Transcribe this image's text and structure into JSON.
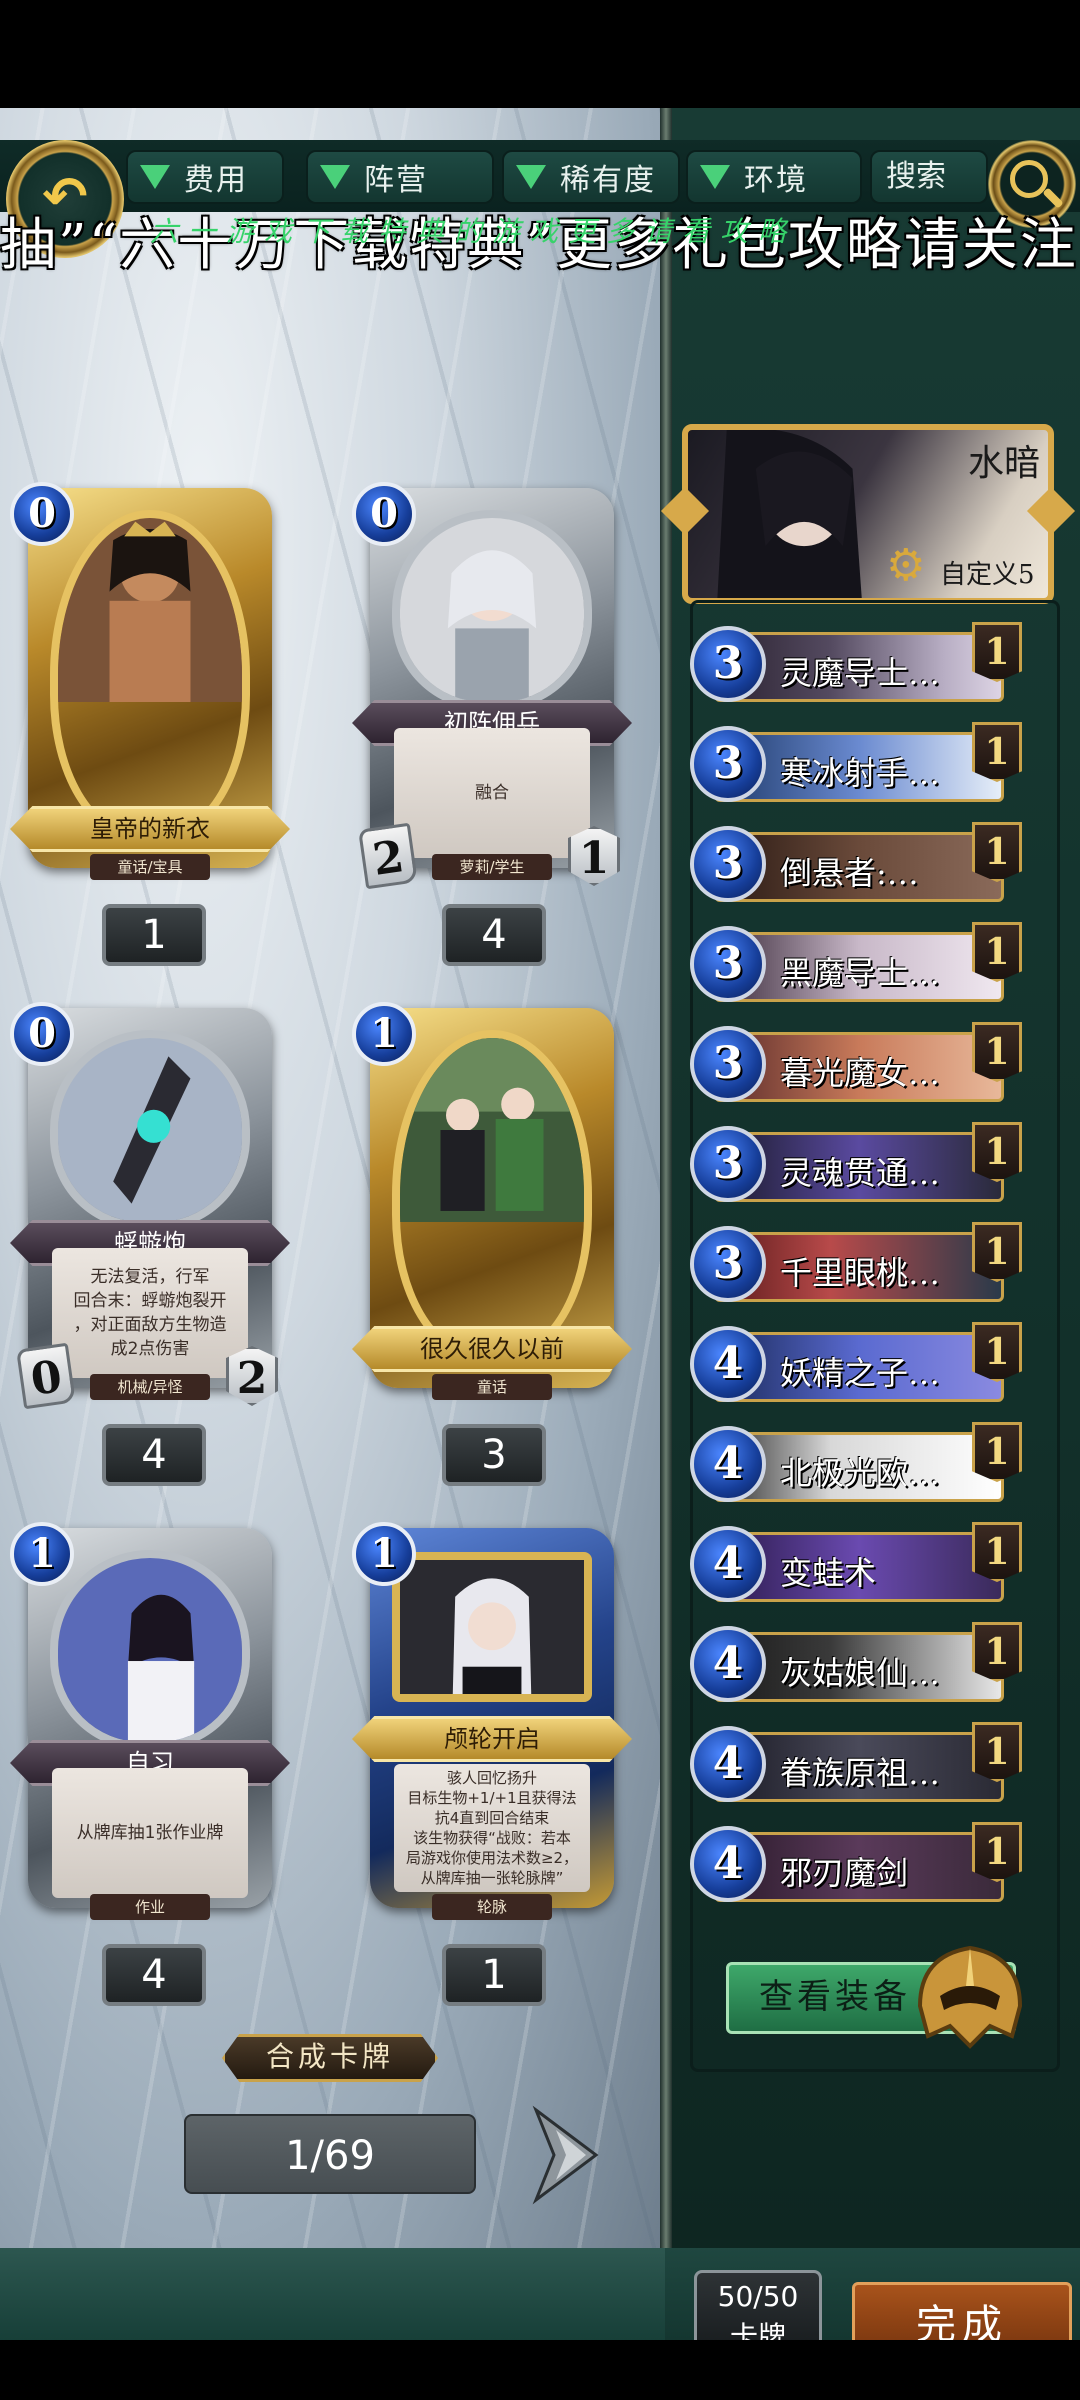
{
  "filters": {
    "back_icon": "back-arrow-icon",
    "cost": "费用",
    "faction": "阵营",
    "rarity": "稀有度",
    "environment": "环境",
    "search": "搜索",
    "search_icon": "magnifier-icon"
  },
  "banner": {
    "main": "抽”“六十万下载特典”更多礼包攻略请关注",
    "overlay": "六一游戏下载特典的游戏更多请看攻略"
  },
  "cards": [
    {
      "cost": "0",
      "name": "皇帝的新衣",
      "tribe": "童话/宝具",
      "text": "",
      "atk": "",
      "hp": "",
      "qty": "1",
      "frame": "gold"
    },
    {
      "cost": "0",
      "name": "初阵佣兵",
      "tribe": "萝莉/学生",
      "text": "融合",
      "atk": "2",
      "hp": "1",
      "qty": "4",
      "frame": "silver"
    },
    {
      "cost": "0",
      "name": "蜉蝣炮",
      "tribe": "机械/异怪",
      "text": "无法复活，行军\n回合末：蜉蝣炮裂开\n，对正面敌方生物造\n成2点伤害",
      "atk": "0",
      "hp": "2",
      "qty": "4",
      "frame": "silver"
    },
    {
      "cost": "1",
      "name": "很久很久以前",
      "tribe": "童话",
      "text": "",
      "atk": "",
      "hp": "",
      "qty": "3",
      "frame": "gold"
    },
    {
      "cost": "1",
      "name": "自习",
      "tribe": "作业",
      "text": "从牌库抽1张作业牌",
      "atk": "",
      "hp": "",
      "qty": "4",
      "frame": "silver"
    },
    {
      "cost": "1",
      "name": "颅轮开启",
      "tribe": "轮脉",
      "text": "骇人回忆扬升\n目标生物+1/+1且获得法\n抗4直到回合结束\n该生物获得“战败：若本\n局游戏你使用法术数≥2，\n从牌库抽一张轮脉牌”",
      "atk": "",
      "hp": "",
      "qty": "1",
      "frame": "blue"
    }
  ],
  "synth_label": "合成卡牌",
  "pager": "1/69",
  "hero": {
    "name": "水暗",
    "subtitle": "自定义5",
    "gear_icon": "gear-icon"
  },
  "deck": [
    {
      "cost": "3",
      "name": "灵魔导士…",
      "count": "1"
    },
    {
      "cost": "3",
      "name": "寒冰射手…",
      "count": "1"
    },
    {
      "cost": "3",
      "name": "倒悬者:…",
      "count": "1"
    },
    {
      "cost": "3",
      "name": "黑魔导士…",
      "count": "1"
    },
    {
      "cost": "3",
      "name": "暮光魔女…",
      "count": "1"
    },
    {
      "cost": "3",
      "name": "灵魂贯通…",
      "count": "1"
    },
    {
      "cost": "3",
      "name": "千里眼桃…",
      "count": "1"
    },
    {
      "cost": "4",
      "name": "妖精之子…",
      "count": "1"
    },
    {
      "cost": "4",
      "name": "北极光欧…",
      "count": "1"
    },
    {
      "cost": "4",
      "name": "变蛙术",
      "count": "1"
    },
    {
      "cost": "4",
      "name": "灰姑娘仙…",
      "count": "1"
    },
    {
      "cost": "4",
      "name": "眷族原祖…",
      "count": "1"
    },
    {
      "cost": "4",
      "name": "邪刃魔剑",
      "count": "1"
    }
  ],
  "equip_label": "查看装备",
  "deck_count": {
    "value": "50/50",
    "label": "卡牌"
  },
  "done_label": "完成",
  "colors": {
    "accent_gold": "#c9a24a",
    "panel_green": "#183b34",
    "cost_blue": "#163e9a",
    "done_orange": "#a8531b"
  }
}
